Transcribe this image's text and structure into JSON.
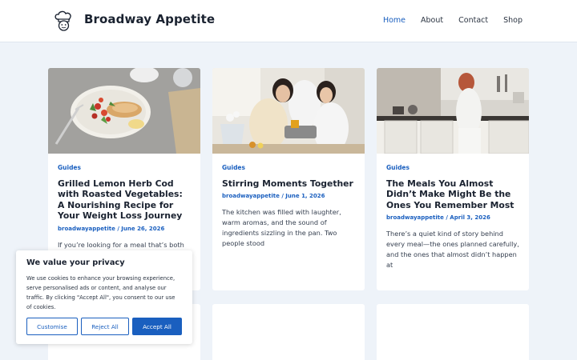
{
  "header": {
    "site_title": "Broadway Appetite",
    "logo_icon": "chef-hat-icon",
    "nav": [
      {
        "label": "Home",
        "active": true
      },
      {
        "label": "About"
      },
      {
        "label": "Contact"
      },
      {
        "label": "Shop"
      }
    ]
  },
  "posts": [
    {
      "category": "Guides",
      "title": "Grilled Lemon Herb Cod with Roasted Vegetables: A Nourishing Recipe for Your Weight Loss Journey",
      "meta": "broadwayappetite / June 26, 2026",
      "excerpt": "If you’re looking for a meal that’s both"
    },
    {
      "category": "Guides",
      "title": "Stirring Moments Together",
      "meta": "broadwayappetite / June 1, 2026",
      "excerpt": "The kitchen was filled with laughter, warm aromas, and the sound of ingredients sizzling in the pan. Two people stood"
    },
    {
      "category": "Guides",
      "title": "The Meals You Almost Didn’t Make Might Be the Ones You Remember Most",
      "meta": "broadwayappetite / April 3, 2026",
      "excerpt": "There’s a quiet kind of story behind every meal—the ones planned carefully, and the ones that almost didn’t happen at"
    }
  ],
  "cookie": {
    "title": "We value your privacy",
    "text": "We use cookies to enhance your browsing experience, serve personalised ads or content, and analyse our traffic. By clicking \"Accept All\", you consent to our use of cookies.",
    "customise": "Customise",
    "reject": "Reject All",
    "accept": "Accept All"
  },
  "colors": {
    "accent": "#1a5fbf",
    "background": "#eef3f9"
  }
}
